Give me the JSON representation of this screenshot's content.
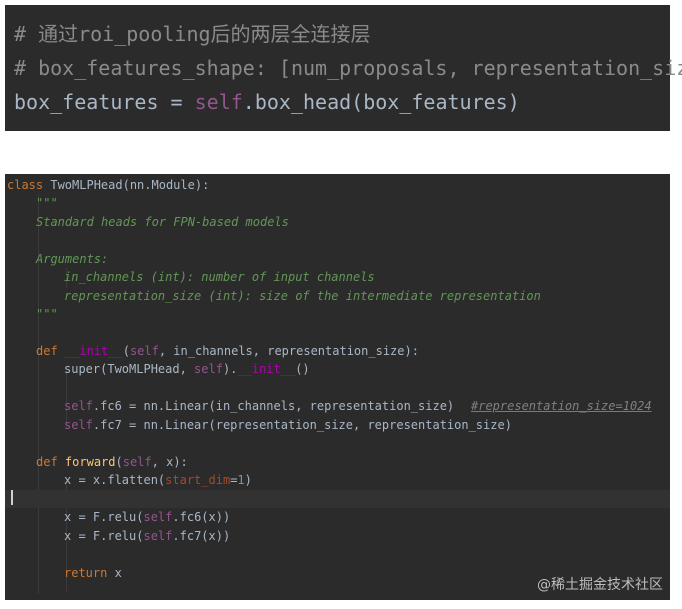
{
  "top_snippet": {
    "comment_1": "# 通过roi_pooling后的两层全连接层",
    "comment_2": "# box_features_shape: [num_proposals, representation_size]",
    "line_3_lhs": "box_features = ",
    "line_3_self": "self",
    "line_3_rest": ".box_head(box_features)"
  },
  "code": {
    "l1_kw": "class",
    "l1_rest": " TwoMLPHead(nn.Module):",
    "l2": "\"\"\"",
    "l3": "Standard heads for FPN-based models",
    "l5": "Arguments:",
    "l6": "in_channels (int): number of input channels",
    "l7": "representation_size (int): size of the intermediate representation",
    "l8": "\"\"\"",
    "l10_kw": "def",
    "l10_magic": "__init__",
    "l10_open": "(",
    "l10_self": "self",
    "l10_rest": ", in_channels, representation_size):",
    "l11_fn": "super",
    "l11_mid": "(TwoMLPHead, ",
    "l11_self": "self",
    "l11_dot": ").",
    "l11_magic": "__init__",
    "l11_end": "()",
    "l13_self": "self",
    "l13_rest": ".fc6 = nn.Linear(in_channels, representation_size)",
    "l13_comment": "#representation_size=1024",
    "l14_self": "self",
    "l14_rest": ".fc7 = nn.Linear(representation_size, representation_size)",
    "l16_kw": "def",
    "l16_fn": "forward",
    "l16_open": "(",
    "l16_self": "self",
    "l16_rest": ", x):",
    "l17_pre": "x = x.flatten(",
    "l17_param": "start_dim",
    "l17_eq": "=",
    "l17_num": "1",
    "l17_end": ")",
    "l19_pre": "x = F.relu(",
    "l19_self": "self",
    "l19_rest": ".fc6(x))",
    "l20_pre": "x = F.relu(",
    "l20_self": "self",
    "l20_rest": ".fc7(x))",
    "l22_kw": "return",
    "l22_rest": " x"
  },
  "watermark": "@稀土掘金技术社区",
  "colors": {
    "editor_bg": "#2b2b2b",
    "keyword": "#cc7832",
    "self": "#94558d",
    "docstring": "#629755",
    "magic": "#b200b2",
    "comment": "#808080"
  }
}
